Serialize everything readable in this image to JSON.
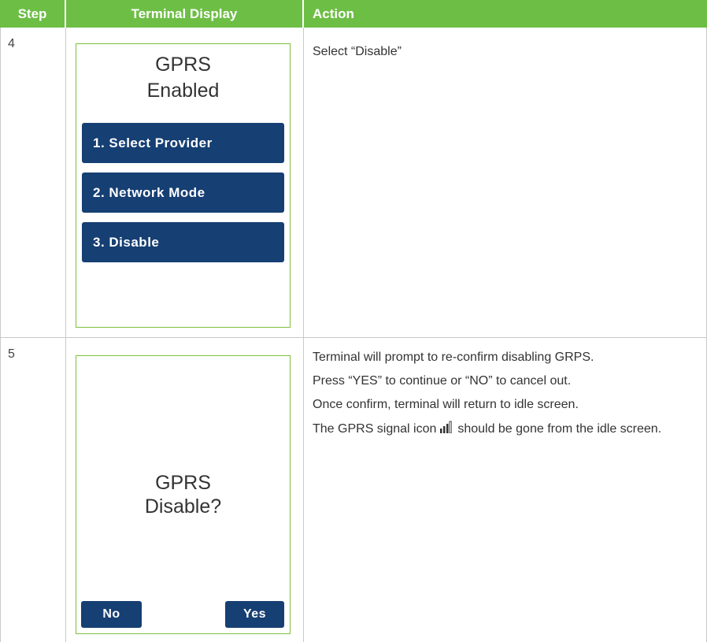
{
  "table": {
    "headers": {
      "step": "Step",
      "display": "Terminal Display",
      "action": "Action"
    },
    "rows": [
      {
        "step": "4",
        "screen": {
          "title_line1": "GPRS",
          "title_line2": "Enabled",
          "menu": [
            "1. Select Provider",
            "2. Network Mode",
            "3. Disable"
          ]
        },
        "action": [
          "Select “Disable”"
        ]
      },
      {
        "step": "5",
        "screen": {
          "title_line1": "GPRS",
          "title_line2": "Disable?",
          "left_button": "No",
          "right_button": "Yes"
        },
        "action": [
          "Terminal will prompt to re-confirm disabling GRPS.",
          "Press “YES” to continue or “NO” to cancel out.",
          "Once confirm, terminal will return to idle screen."
        ],
        "action_last_before_icon": "The GPRS signal icon",
        "action_last_after_icon": "should be gone from the idle screen."
      }
    ]
  },
  "colors": {
    "header_green": "#6dbe45",
    "button_navy": "#163f73",
    "screen_border": "#7fbf3f"
  },
  "icons": {
    "signal": "signal-strength-icon"
  }
}
